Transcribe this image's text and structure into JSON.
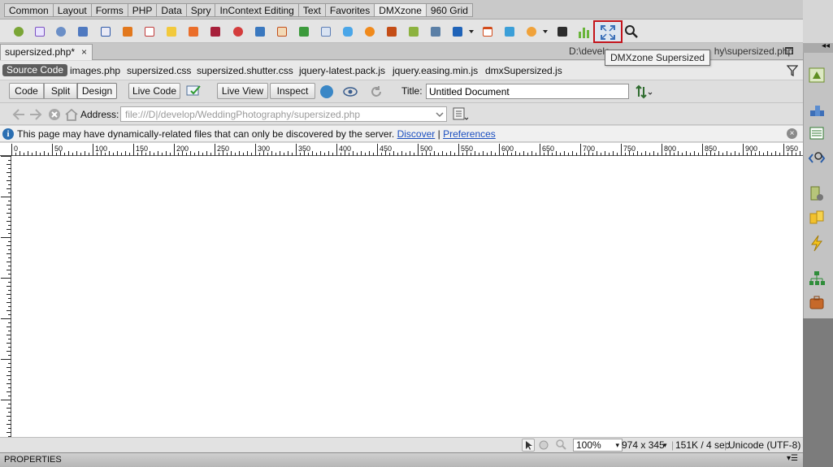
{
  "insert_bar": {
    "tabs": [
      "Common",
      "Layout",
      "Forms",
      "PHP",
      "Data",
      "Spry",
      "InContext Editing",
      "Text",
      "Favorites",
      "DMXzone",
      "960 Grid"
    ],
    "active_tab": "DMXzone",
    "tooltip": "DMXzone Supersized"
  },
  "document": {
    "tab_label": "supersized.php*",
    "close_glyph": "×",
    "path": "D:\\develop\\WeddingPhotography\\supersized.php",
    "path_visible": "D:\\develo",
    "path_visible_end": "hy\\supersized.php"
  },
  "related_files": {
    "source_label": "Source Code",
    "files": [
      "images.php",
      "supersized.css",
      "supersized.shutter.css",
      "jquery-latest.pack.js",
      "jquery.easing.min.js",
      "dmxSupersized.js"
    ]
  },
  "doc_toolbar": {
    "code": "Code",
    "split": "Split",
    "design": "Design",
    "live_code": "Live Code",
    "live_view": "Live View",
    "inspect": "Inspect",
    "title_label": "Title:",
    "title_value": "Untitled Document"
  },
  "nav": {
    "address_label": "Address:",
    "address_value": "file:///D|/develop/WeddingPhotography/supersized.php"
  },
  "info_bar": {
    "message": "This page may have dynamically-related files that can only be discovered by the server.",
    "discover": "Discover",
    "separator": "|",
    "preferences": "Preferences"
  },
  "ruler": {
    "ticks": [
      "0",
      "50",
      "100",
      "150",
      "200",
      "250",
      "300",
      "350",
      "400",
      "450",
      "500",
      "550",
      "600",
      "650",
      "700",
      "750",
      "800",
      "850",
      "900",
      "950"
    ]
  },
  "status_bar": {
    "zoom": "100%",
    "dimensions": "974 x 345",
    "size": "151K / 4 sec",
    "encoding": "Unicode (UTF-8)"
  },
  "properties": {
    "title": "PROPERTIES"
  },
  "colors": {
    "highlight_border": "#c4141b",
    "link": "#1a4ec0",
    "info_icon": "#2b6fb2"
  }
}
